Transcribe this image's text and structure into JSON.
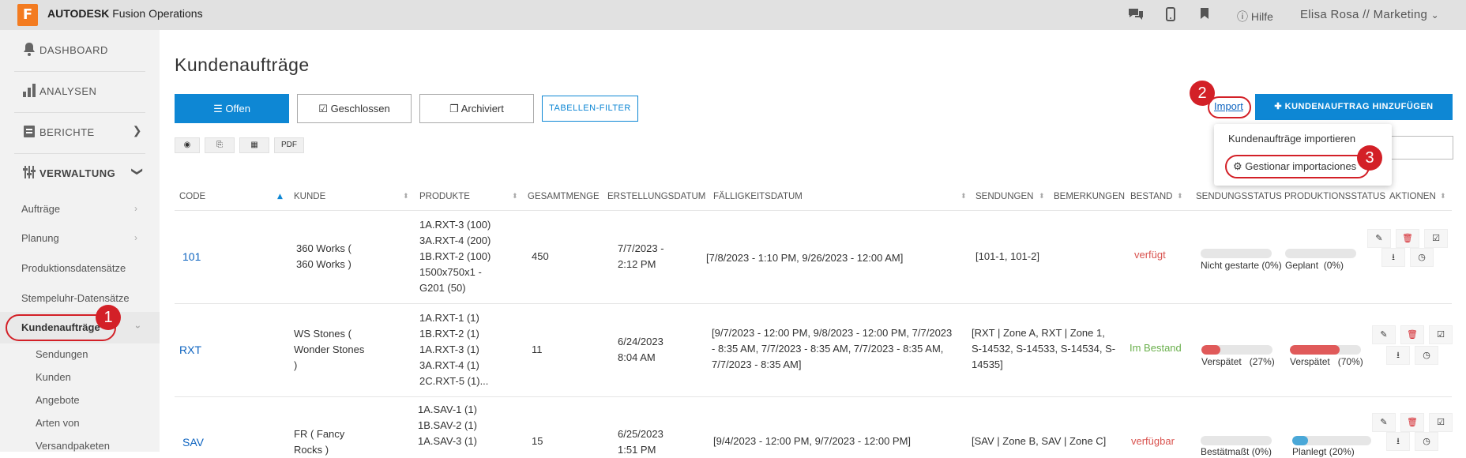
{
  "topbar": {
    "logo_letter": "F",
    "brand_bold": "AUTODESK",
    "brand_rest": " Fusion Operations",
    "help_label": "Hilfe",
    "user_label": "Elisa Rosa // Marketing"
  },
  "sidebar": {
    "dashboard": "DASHBOARD",
    "analysen": "ANALYSEN",
    "berichte": "BERICHTE",
    "verwaltung": "VERWALTUNG",
    "sub_items": [
      "Aufträge",
      "Planung",
      "Produktionsdatensätze",
      "Stempeluhr-Datensätze",
      "Kundenaufträge"
    ],
    "sub_sub_items": [
      "Sendungen",
      "Kunden",
      "Angebote",
      "Arten von",
      "Versandpaketen"
    ]
  },
  "main": {
    "title": "Kundenaufträge",
    "tabs": {
      "offen": "Offen",
      "geschlossen": "Geschlossen",
      "archiviert": "Archiviert",
      "filter": "TABELLEN-FILTER"
    },
    "mini_pdf": "PDF",
    "import_label": "Import",
    "add_label": "KUNDENAUFTRAG HINZUFÜGEN",
    "dropdown": {
      "item1": "Kundenaufträge importieren",
      "item2": "Gestionar importaciones"
    }
  },
  "callouts": {
    "one": "1",
    "two": "2",
    "three": "3"
  },
  "table": {
    "headers": [
      "CODE",
      "KUNDE",
      "PRODUKTE",
      "GESAMTMENGE",
      "ERSTELLUNGSDATUM",
      "FÄLLIGKEITSDATUM",
      "SENDUNGEN",
      "BEMERKUNGEN",
      "BESTAND",
      "SENDUNGSSTATUS",
      "PRODUKTIONSSTATUS",
      "AKTIONEN"
    ],
    "rows": [
      {
        "code": "101",
        "kunde": "360 Works (\n360 Works )",
        "produkte": "1A.RXT-3 (100)\n3A.RXT-4 (200)\n1B.RXT-2 (100)\n1500x750x1 -\nG201 (50)",
        "menge": "450",
        "erstellung": "7/7/2023 -\n2:12 PM",
        "faelligkeit": "[7/8/2023 - 1:10 PM, 9/26/2023 - 12:00 AM]",
        "sendungen": "[101-1, 101-2]",
        "bestand": "verfügt",
        "bestand_color": "#d9534f",
        "s_status": "Nicht gestarte",
        "s_pct": "(0%)",
        "s_value": 0,
        "p_status": "Geplant",
        "p_pct": "(0%)",
        "p_value": 0
      },
      {
        "code": "RXT",
        "kunde": "WS Stones (\nWonder Stones\n)",
        "produkte": "1A.RXT-1 (1)\n1B.RXT-2 (1)\n1A.RXT-3 (1)\n3A.RXT-4 (1)\n2C.RXT-5 (1)...",
        "menge": "11",
        "erstellung": "6/24/2023\n8:04 AM",
        "faelligkeit": "[9/7/2023 - 12:00 PM, 9/8/2023 - 12:00 PM, 7/7/2023\n- 8:35 AM, 7/7/2023 - 8:35 AM, 7/7/2023 - 8:35 AM,\n7/7/2023 - 8:35 AM]",
        "sendungen": "[RXT | Zone A, RXT | Zone 1,\nS-14532, S-14533, S-14534, S-\n14535]",
        "bestand": "Im Bestand",
        "bestand_color": "#6ab04c",
        "s_status": "Verspätet",
        "s_pct": "(27%)",
        "s_value": 0.27,
        "p_status": "Verspätet",
        "p_pct": "(70%)",
        "p_value": 0.7
      },
      {
        "code": "SAV",
        "kunde": "FR ( Fancy\nRocks )",
        "produkte": "1A.SAV-1 (1)\n1B.SAV-2 (1)\n1A.SAV-3 (1)",
        "menge": "15",
        "erstellung": "6/25/2023\n1:51 PM",
        "faelligkeit": "[9/4/2023 - 12:00 PM, 9/7/2023 - 12:00 PM]",
        "sendungen": "[SAV | Zone B, SAV | Zone C]",
        "bestand": "verfügbar",
        "bestand_color": "#d9534f",
        "s_status": "Bestätmaßt",
        "s_pct": "(0%)",
        "s_value": 0,
        "p_status": "Planlegt",
        "p_pct": "(20%)",
        "p_value": 0.2
      }
    ]
  },
  "colors": {
    "accent": "#0e87d4",
    "callout": "#d32027",
    "late_fill": "#e05a5a",
    "plan_fill": "#4aa8d8"
  }
}
